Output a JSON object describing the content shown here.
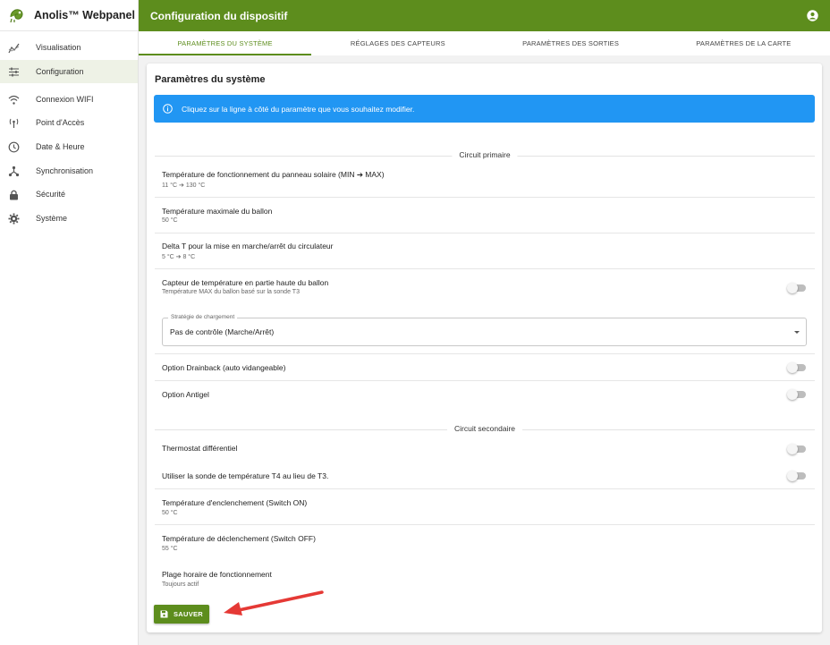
{
  "app": {
    "name": "Anolis™ Webpanel"
  },
  "header": {
    "title": "Configuration du dispositif"
  },
  "sidebar": {
    "items": [
      {
        "label": "Visualisation",
        "icon": "chart-icon"
      },
      {
        "label": "Configuration",
        "icon": "sliders-icon",
        "active": true
      },
      {
        "label": "Connexion WIFI",
        "icon": "wifi-icon"
      },
      {
        "label": "Point d'Accès",
        "icon": "antenna-icon"
      },
      {
        "label": "Date & Heure",
        "icon": "clock-icon"
      },
      {
        "label": "Synchronisation",
        "icon": "share-icon"
      },
      {
        "label": "Sécurité",
        "icon": "lock-icon"
      },
      {
        "label": "Système",
        "icon": "gear-icon"
      }
    ]
  },
  "tabs": [
    {
      "label": "Paramètres du système",
      "active": true
    },
    {
      "label": "Réglages des capteurs"
    },
    {
      "label": "Paramètres des sorties"
    },
    {
      "label": "Paramètres de la carte"
    }
  ],
  "card": {
    "title": "Paramètres du système",
    "info": "Cliquez sur la ligne à côté du paramètre que vous souhaitez modifier."
  },
  "sections": {
    "primary": "Circuit primaire",
    "secondary": "Circuit secondaire"
  },
  "params": {
    "solar_temp": {
      "label": "Température de fonctionnement du panneau solaire (MIN ➔ MAX)",
      "value": "11 °C ➔ 130 °C"
    },
    "tank_max": {
      "label": "Température maximale du ballon",
      "value": "50 °C"
    },
    "delta_t": {
      "label": "Delta T pour la mise en marche/arrêt du circulateur",
      "value": "5 °C ➔ 8 °C"
    },
    "top_sensor": {
      "label": "Capteur de température en partie haute du ballon",
      "value": "Température MAX du ballon basé sur la sonde T3",
      "enabled": false
    },
    "loading_strategy": {
      "legend": "Stratégie de chargement",
      "value": "Pas de contrôle (Marche/Arrêt)"
    },
    "drainback": {
      "label": "Option Drainback (auto vidangeable)",
      "enabled": false
    },
    "antifreeze": {
      "label": "Option Antigel",
      "enabled": false
    },
    "diff_thermostat": {
      "label": "Thermostat différentiel",
      "enabled": false
    },
    "use_t4": {
      "label": "Utiliser la sonde de température T4 au lieu de T3.",
      "enabled": false
    },
    "switch_on": {
      "label": "Température d'enclenchement (Switch ON)",
      "value": "50 °C"
    },
    "switch_off": {
      "label": "Température de déclenchement (Switch OFF)",
      "value": "55 °C"
    },
    "schedule": {
      "label": "Plage horaire de fonctionnement",
      "value": "Toujours actif"
    }
  },
  "actions": {
    "save_label": "SAUVER"
  },
  "colors": {
    "brand": "#5d8d1d",
    "info": "#2196f3",
    "annotation_arrow": "#e53935"
  }
}
